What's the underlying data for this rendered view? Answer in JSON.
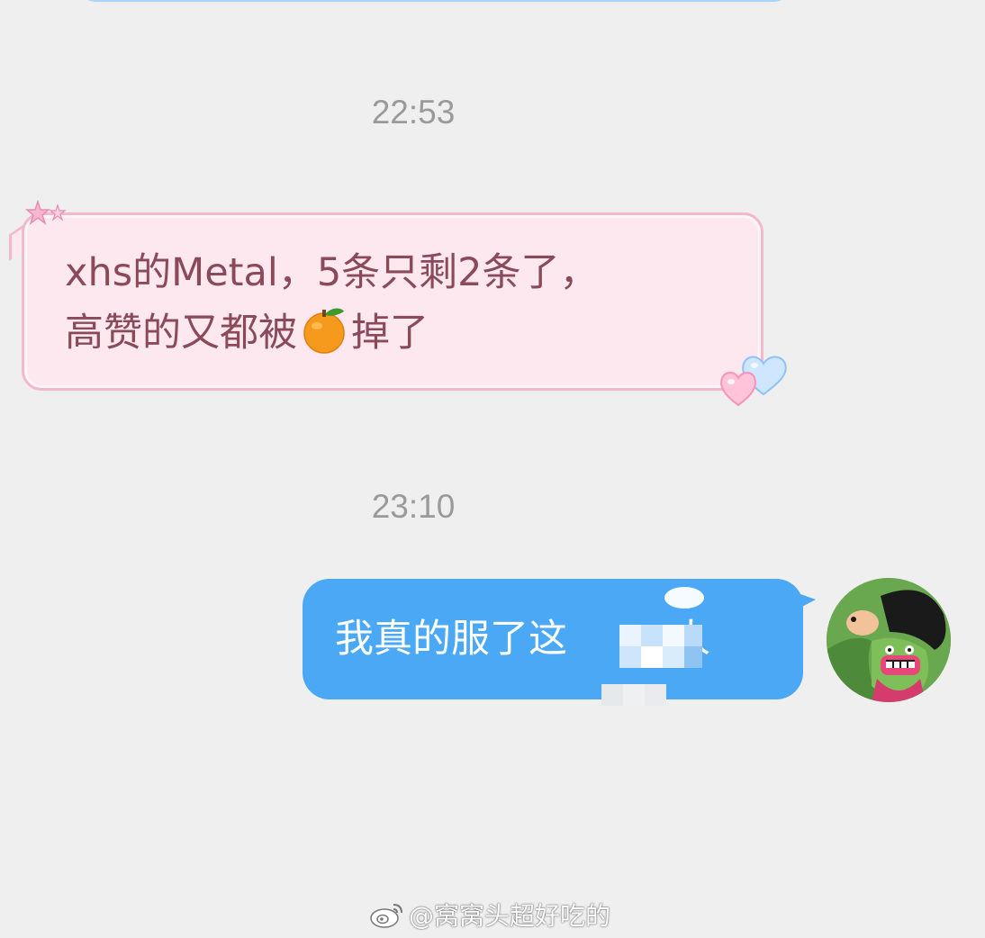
{
  "timestamps": [
    "22:53",
    "23:10"
  ],
  "messages": {
    "received": {
      "line1": "xhs的Metal，5条只剩2条了，",
      "line2_before": "高赞的又都被",
      "line2_emoji": "orange-emoji",
      "line2_after": "掉了"
    },
    "sent": {
      "visible_start": "我真的服了这",
      "visible_end": "人"
    }
  },
  "watermark": {
    "icon": "weibo-icon",
    "text": "@窝窝头超好吃的"
  },
  "colors": {
    "background": "#efefef",
    "received_bubble": "#fde8ef",
    "received_border": "#f3b8cb",
    "received_text": "#8a4a5a",
    "sent_bubble": "#4aa8f5",
    "timestamp": "#9a9a9a"
  }
}
